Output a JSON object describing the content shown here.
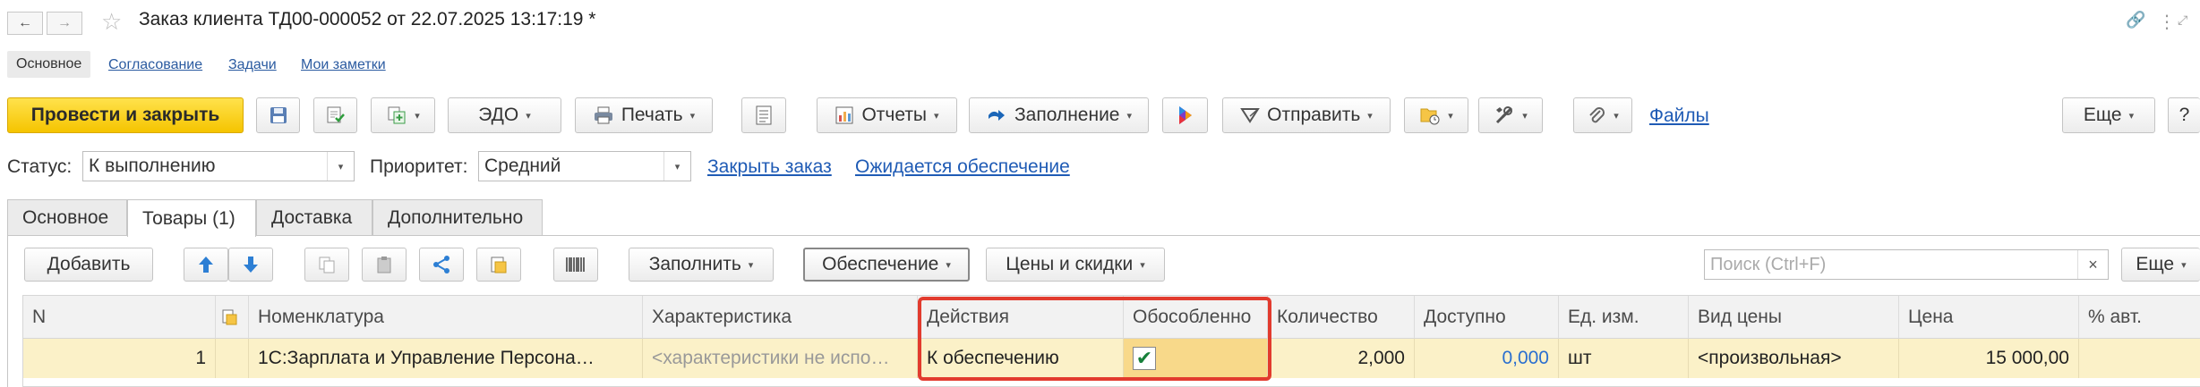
{
  "window": {
    "title": "Заказ клиента ТД00-000052 от 22.07.2025 13:17:19 *",
    "back_icon": "←",
    "forward_icon": "→",
    "favorite_icon": "☆",
    "link_icon": "🔗",
    "more_icon": "⋮"
  },
  "sections": {
    "active": "Основное",
    "links": [
      "Согласование",
      "Задачи",
      "Мои заметки"
    ]
  },
  "toolbar": {
    "post_close": "Провести и закрыть",
    "edo": "ЭДО",
    "print": "Печать",
    "reports": "Отчеты",
    "fill": "Заполнение",
    "send": "Отправить",
    "files": "Файлы",
    "more": "Еще",
    "help": "?"
  },
  "status_row": {
    "status_label": "Статус:",
    "status_value": "К выполнению",
    "priority_label": "Приоритет:",
    "priority_value": "Средний",
    "close_order_link": "Закрыть заказ",
    "awaiting_link": "Ожидается обеспечение"
  },
  "tabs": [
    "Основное",
    "Товары (1)",
    "Доставка",
    "Дополнительно"
  ],
  "active_tab": "Товары (1)",
  "table_toolbar": {
    "add": "Добавить",
    "fill": "Заполнить",
    "provision": "Обеспечение",
    "prices": "Цены и скидки",
    "search_placeholder": "Поиск (Ctrl+F)",
    "search_clear": "×",
    "more": "Еще"
  },
  "table": {
    "columns": [
      "N",
      "",
      "Номенклатура",
      "Характеристика",
      "Действия",
      "Обособленно",
      "Количество",
      "Доступно",
      "Ед. изм.",
      "Вид цены",
      "Цена",
      "% авт."
    ],
    "rows": [
      {
        "n": "1",
        "nomenclature": "1С:Зарплата и Управление Персона…",
        "characteristic": "<характеристики не испо…",
        "action": "К обеспечению",
        "separate": true,
        "quantity": "2,000",
        "available": "0,000",
        "unit": "шт",
        "price_type": "<произвольная>",
        "price": "15 000,00",
        "auto_pct": ""
      }
    ]
  },
  "colors": {
    "primary_button": "#f5c400",
    "link": "#1f5bb5",
    "selected_row": "#fbf1c8",
    "highlight_border": "#e23b2e",
    "checkmark": "#17803a"
  }
}
